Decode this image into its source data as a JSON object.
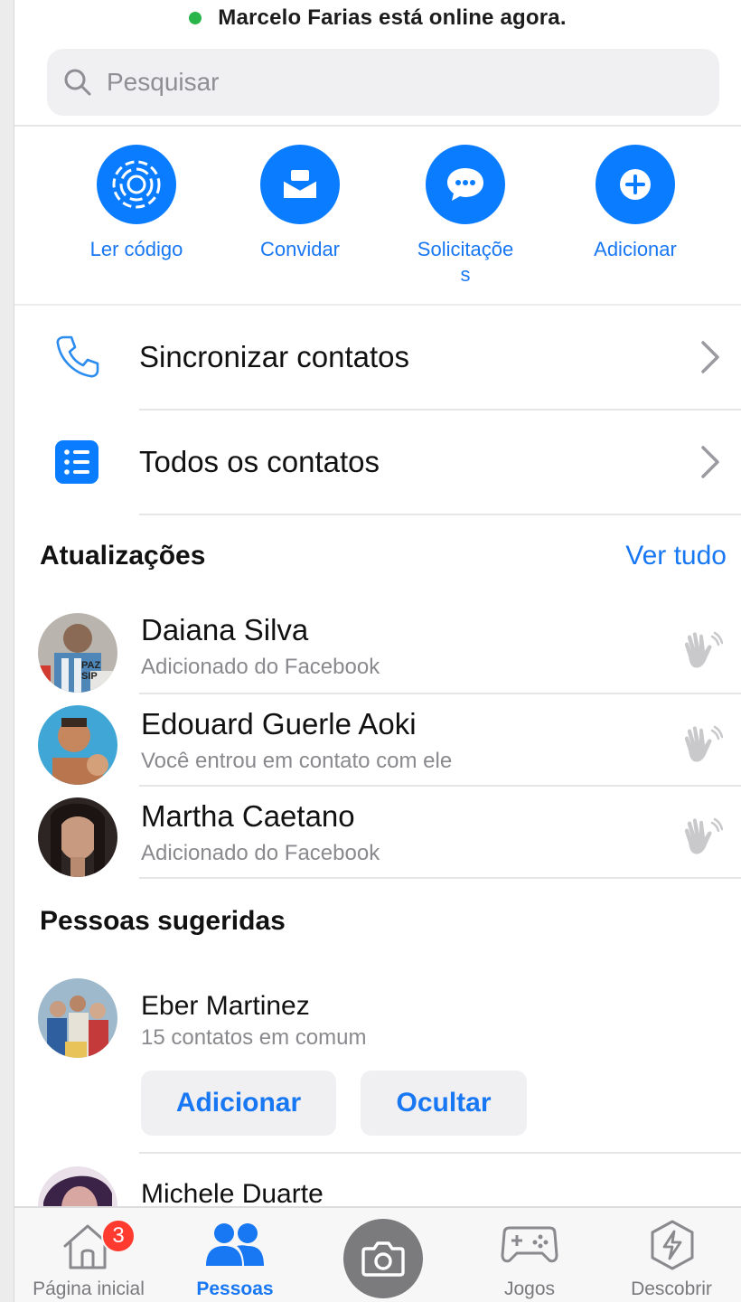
{
  "status": {
    "online_text": "Marcelo Farias está online agora."
  },
  "search": {
    "placeholder": "Pesquisar"
  },
  "actions": [
    {
      "label": "Ler código",
      "icon": "qr-scan-icon"
    },
    {
      "label": "Convidar",
      "icon": "invite-envelope-icon"
    },
    {
      "label_line1": "Solicitaçõe",
      "label_line2": "s",
      "icon": "chat-bubble-icon"
    },
    {
      "label": "Adicionar",
      "icon": "plus-icon"
    }
  ],
  "menu": [
    {
      "label": "Sincronizar contatos",
      "icon": "phone-icon"
    },
    {
      "label": "Todos os contatos",
      "icon": "list-icon"
    }
  ],
  "updates": {
    "title": "Atualizações",
    "see_all": "Ver tudo",
    "items": [
      {
        "name": "Daiana Silva",
        "subtitle": "Adicionado do Facebook",
        "avatar_text": "PAZ SIP"
      },
      {
        "name": "Edouard Guerle Aoki",
        "subtitle": "Você entrou em contato com ele"
      },
      {
        "name": "Martha Caetano",
        "subtitle": "Adicionado do Facebook"
      }
    ]
  },
  "suggested": {
    "title": "Pessoas sugeridas",
    "items": [
      {
        "name": "Eber Martinez",
        "subtitle": "15 contatos em comum",
        "add_label": "Adicionar",
        "hide_label": "Ocultar"
      },
      {
        "name": "Michele Duarte"
      }
    ]
  },
  "tabbar": {
    "home": {
      "label": "Página inicial",
      "badge": "3"
    },
    "people": {
      "label": "Pessoas"
    },
    "games": {
      "label": "Jogos"
    },
    "discover": {
      "label": "Descobrir"
    }
  },
  "colors": {
    "accent": "#1877f2",
    "icon_blue": "#0a7cff",
    "online": "#2ab54a",
    "badge": "#ff3b30"
  }
}
